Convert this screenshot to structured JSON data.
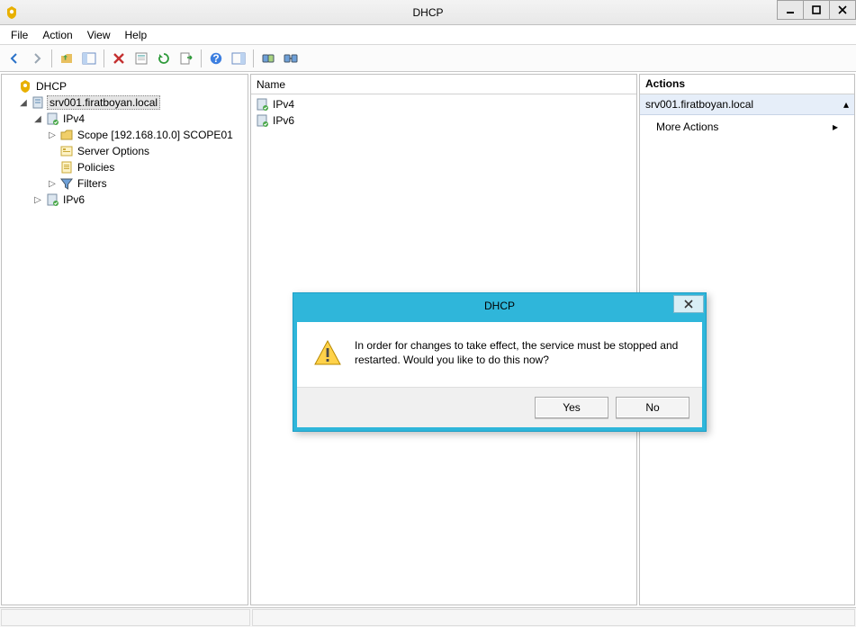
{
  "window": {
    "title": "DHCP"
  },
  "menu": {
    "file": "File",
    "action": "Action",
    "view": "View",
    "help": "Help"
  },
  "tree": {
    "root": "DHCP",
    "server": "srv001.firatboyan.local",
    "ipv4": "IPv4",
    "scope": "Scope [192.168.10.0] SCOPE01",
    "server_options": "Server Options",
    "policies": "Policies",
    "filters": "Filters",
    "ipv6": "IPv6"
  },
  "list": {
    "header_name": "Name",
    "rows": {
      "ipv4": "IPv4",
      "ipv6": "IPv6"
    }
  },
  "actions": {
    "header": "Actions",
    "group": "srv001.firatboyan.local",
    "more": "More Actions"
  },
  "dialog": {
    "title": "DHCP",
    "message": "In order for changes to take effect, the service must be stopped and restarted.  Would you like to do this now?",
    "yes": "Yes",
    "no": "No"
  }
}
